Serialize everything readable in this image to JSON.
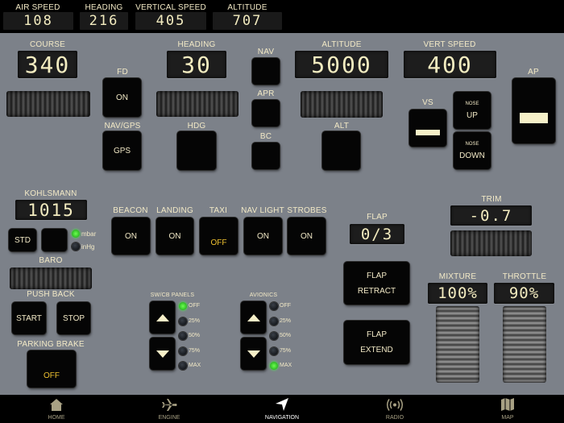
{
  "top": {
    "airspeed_label": "AIR SPEED",
    "airspeed": "108",
    "heading_label": "HEADING",
    "heading": "216",
    "vs_label": "VERTICAL SPEED",
    "vs": "405",
    "alt_label": "ALTITUDE",
    "alt": "707"
  },
  "ap": {
    "course_label": "COURSE",
    "course": "340",
    "fd_label": "FD",
    "fd": "ON",
    "navgps_label": "NAV/GPS",
    "navgps": "GPS",
    "heading_label": "HEADING",
    "heading": "30",
    "hdg_label": "HDG",
    "nav_label": "NAV",
    "apr_label": "APR",
    "bc_label": "BC",
    "altitude_label": "ALTITUDE",
    "altitude": "5000",
    "alt_label": "ALT",
    "vspeed_label": "VERT SPEED",
    "vspeed": "400",
    "vs_label": "VS",
    "nose": "NOSE",
    "up": "UP",
    "down": "DOWN",
    "ap_label": "AP"
  },
  "baro": {
    "kohlsmann_label": "KOHLSMANN",
    "kohlsmann": "1015",
    "std": "STD",
    "mbar": "mbar",
    "inhg": "inHg",
    "unit_selected": "mbar",
    "baro_label": "BARO"
  },
  "pushback": {
    "label": "PUSH BACK",
    "start": "START",
    "stop": "STOP"
  },
  "parking": {
    "label": "PARKING BRAKE",
    "state": "OFF"
  },
  "lights": [
    {
      "label": "BEACON",
      "state": "ON"
    },
    {
      "label": "LANDING",
      "state": "ON"
    },
    {
      "label": "TAXI",
      "state": "OFF"
    },
    {
      "label": "NAV LIGHT",
      "state": "ON"
    },
    {
      "label": "STROBES",
      "state": "ON"
    }
  ],
  "panels": {
    "swcb_label": "SW/CB PANELS",
    "avionics_label": "AVIONICS",
    "levels": [
      "OFF",
      "25%",
      "50%",
      "75%",
      "MAX"
    ],
    "swcb_selected": "OFF",
    "avionics_selected": "MAX"
  },
  "flap": {
    "label": "FLAP",
    "value": "0/3",
    "retract_1": "FLAP",
    "retract_2": "RETRACT",
    "extend_1": "FLAP",
    "extend_2": "EXTEND"
  },
  "trim": {
    "label": "TRIM",
    "value": "-0.7"
  },
  "engine": {
    "mixture_label": "MIXTURE",
    "mixture": "100%",
    "throttle_label": "THROTTLE",
    "throttle": "90%"
  },
  "nav": [
    {
      "label": "HOME",
      "icon": "home-icon"
    },
    {
      "label": "ENGINE",
      "icon": "airplane-icon"
    },
    {
      "label": "NAVIGATION",
      "icon": "navigation-arrow-icon",
      "active": true
    },
    {
      "label": "RADIO",
      "icon": "radio-icon"
    },
    {
      "label": "MAP",
      "icon": "map-icon"
    }
  ],
  "colors": {
    "panel": "#7c8189",
    "cream": "#f2e9c6",
    "off": "#f0c230",
    "led_on": "#3ce030"
  }
}
